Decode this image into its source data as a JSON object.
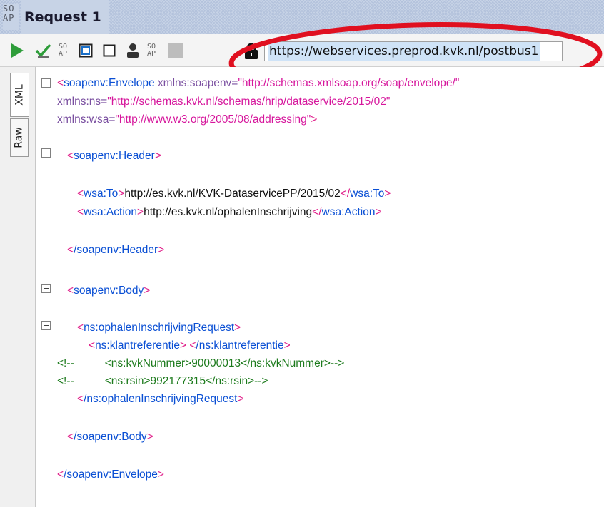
{
  "window": {
    "logo_top": "SO",
    "logo_bottom": "AP",
    "title": "Request 1"
  },
  "toolbar": {
    "endpoint_url": "https://webservices.preprod.kvk.nl/postbus1",
    "mini_soap_top": "SO",
    "mini_soap_bottom": "AP"
  },
  "side_tabs": {
    "xml_label": "XML",
    "raw_label": "Raw"
  },
  "editor": {
    "l1_open": "<",
    "l1_tag": "soapenv:Envelope",
    "l1_attr": " xmlns:soapenv=",
    "l1_val": "\"http://schemas.xmlsoap.org/soap/envelope/\"",
    "l2_attr": "xmlns:ns=",
    "l2_val": "\"http://schemas.kvk.nl/schemas/hrip/dataservice/2015/02\"",
    "l3_attr": "xmlns:wsa=",
    "l3_val": "\"http://www.w3.org/2005/08/addressing\"",
    "l3_close": ">",
    "header_open_tag": "soapenv:Header",
    "to_tag": "wsa:To",
    "to_text": "http://es.kvk.nl/KVK-DataservicePP/2015/02",
    "action_tag": "wsa:Action",
    "action_text": "http://es.kvk.nl/ophalenInschrijving",
    "header_close_tag": "/soapenv:Header",
    "body_open_tag": "soapenv:Body",
    "req_open_tag": "ns:ophalenInschrijvingRequest",
    "klant_tag": "ns:klantreferentie",
    "klant_close_tag": "/ns:klantreferentie",
    "comment1": "<!--          <ns:kvkNummer>90000013</ns:kvkNummer>-->",
    "comment2": "<!--          <ns:rsin>992177315</ns:rsin>-->",
    "req_close_tag": "/ns:ophalenInschrijvingRequest",
    "body_close_tag": "/soapenv:Body",
    "env_close_tag": "/soapenv:Envelope",
    "lt": "<",
    "gt": ">",
    "lt_slash": "</",
    "space": " "
  }
}
